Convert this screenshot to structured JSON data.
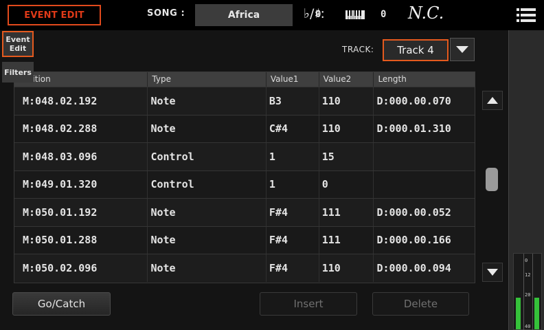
{
  "header": {
    "page_label": "EVENT EDIT",
    "song_label": "SONG :",
    "song_name": "Africa",
    "flat_sharp_symbol": "♭/♯:",
    "flat_sharp_value": "0",
    "transpose_value": "0",
    "chord": "N.C.",
    "menu_icon": "hamburger-menu-icon",
    "keyboard_icon": "keyboard-icon"
  },
  "track": {
    "label": "TRACK:",
    "selected": "Track 4"
  },
  "table": {
    "columns": [
      "Position",
      "Type",
      "Value1",
      "Value2",
      "Length"
    ],
    "rows": [
      [
        "M:048.02.192",
        "Note",
        "B3",
        "110",
        "D:000.00.070"
      ],
      [
        "M:048.02.288",
        "Note",
        "C#4",
        "110",
        "D:000.01.310"
      ],
      [
        "M:048.03.096",
        "Control",
        "1",
        "15",
        ""
      ],
      [
        "M:049.01.320",
        "Control",
        "1",
        "0",
        ""
      ],
      [
        "M:050.01.192",
        "Note",
        "F#4",
        "111",
        "D:000.00.052"
      ],
      [
        "M:050.01.288",
        "Note",
        "F#4",
        "111",
        "D:000.00.166"
      ],
      [
        "M:050.02.096",
        "Note",
        "F#4",
        "110",
        "D:000.00.094"
      ]
    ]
  },
  "buttons": {
    "go_catch": "Go/Catch",
    "insert": "Insert",
    "delete": "Delete"
  },
  "sidebar": {
    "event_edit_line1": "Event",
    "event_edit_line2": "Edit",
    "filters": "Filters"
  },
  "meter": {
    "ticks": [
      "0",
      "12",
      "20",
      "40"
    ]
  },
  "colors": {
    "accent": "#e55a1e",
    "meter_green": "#35c13a"
  }
}
